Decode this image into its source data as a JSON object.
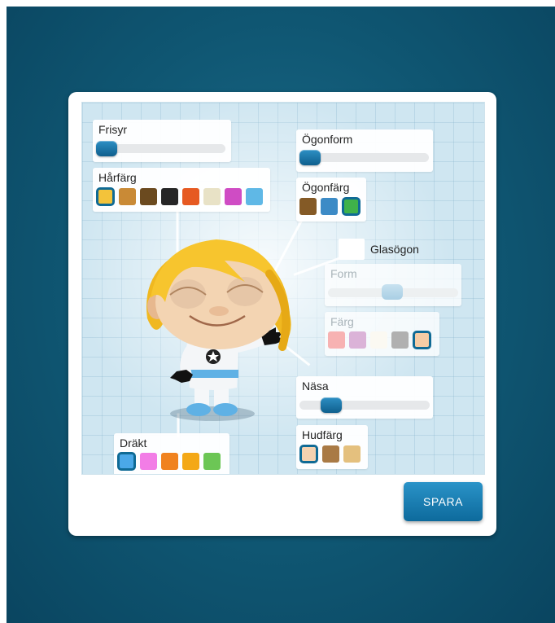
{
  "panels": {
    "hairstyle": {
      "label": "Frisyr",
      "slider_value": 0.0
    },
    "hair_color": {
      "label": "Hårfärg",
      "swatches": [
        "#f3c33a",
        "#c98a36",
        "#6b4a1f",
        "#262626",
        "#e65a22",
        "#e8e2c6",
        "#cf4cc4",
        "#5fb8e6"
      ],
      "selected": 0
    },
    "eye_shape": {
      "label": "Ögonform",
      "slider_value": 0.0
    },
    "eye_color": {
      "label": "Ögonfärg",
      "swatches": [
        "#845a26",
        "#3c8bc6",
        "#3fb24a"
      ],
      "selected": 2
    },
    "glasses": {
      "label": "Glasögon",
      "checked": false
    },
    "glasses_form": {
      "label": "Form",
      "slider_value": 0.5
    },
    "glasses_color": {
      "label": "Färg",
      "swatches": [
        "#f7b2b2",
        "#dbb3d8",
        "#fbf9f2",
        "#b0b0b0",
        "#f5cca5"
      ],
      "selected": 4
    },
    "nose": {
      "label": "Näsa",
      "slider_value": 0.25
    },
    "skin_color": {
      "label": "Hudfärg",
      "swatches": [
        "#f5d2b0",
        "#a97a45",
        "#e4c07e"
      ],
      "selected": 0
    },
    "outfit": {
      "label": "Dräkt",
      "swatches": [
        "#4aa8e8",
        "#f27de6",
        "#f0821f",
        "#f4a816",
        "#6cc655"
      ],
      "selected": 0
    }
  },
  "save_label": "SPARA",
  "colors": {
    "accent": "#0f6a95",
    "background": "#0f5672"
  },
  "character": {
    "icon": "avatar-character-illustration"
  }
}
